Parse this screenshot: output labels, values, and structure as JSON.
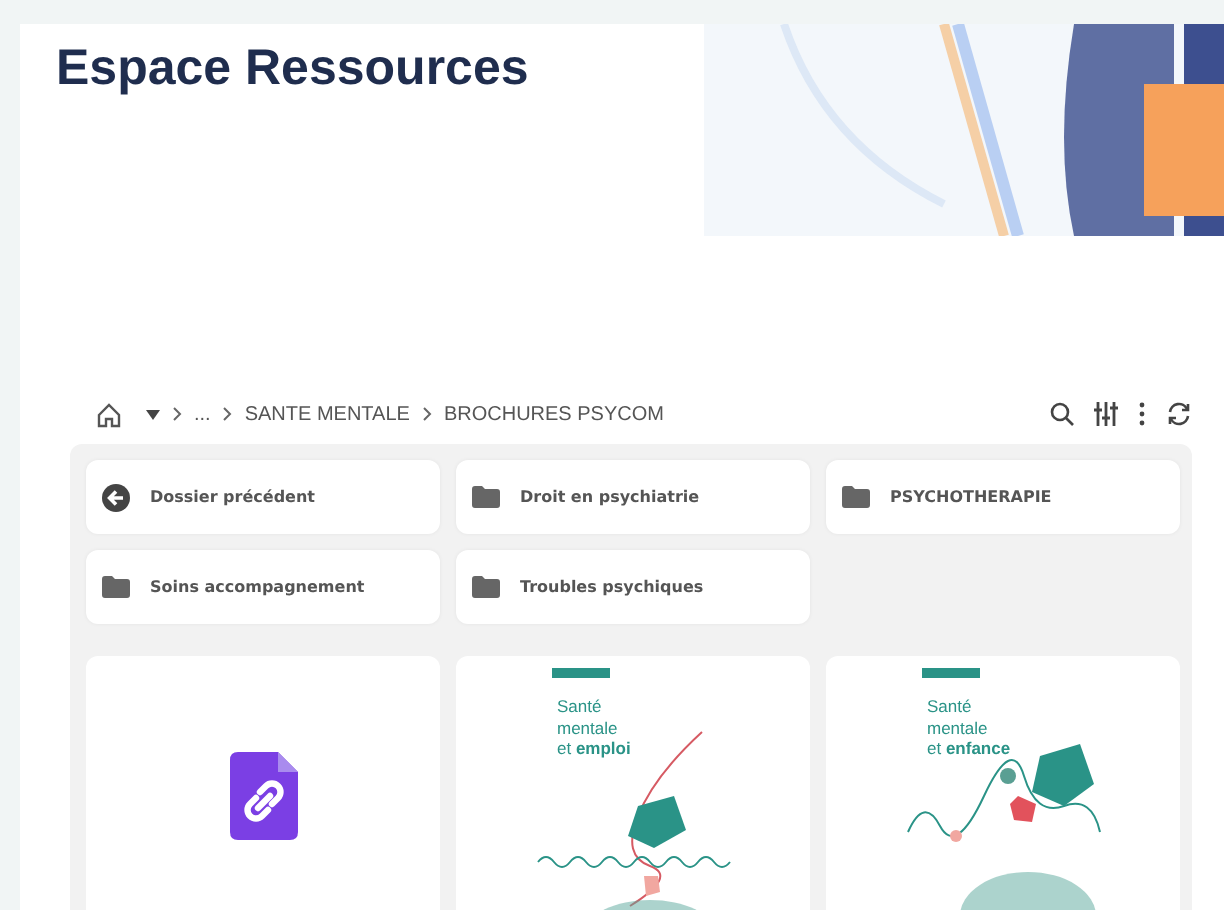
{
  "page": {
    "title": "Espace Ressources"
  },
  "breadcrumb": {
    "ellipsis": "...",
    "items": [
      "SANTE MENTALE",
      "BROCHURES PSYCOM"
    ]
  },
  "folders": [
    {
      "kind": "back",
      "label": "Dossier précédent"
    },
    {
      "kind": "folder",
      "label": "Droit en psychiatrie"
    },
    {
      "kind": "folder",
      "label": "PSYCHOTHERAPIE"
    },
    {
      "kind": "folder",
      "label": "Soins accompagnement"
    },
    {
      "kind": "folder",
      "label": "Troubles psychiques"
    }
  ],
  "files": [
    {
      "kind": "link"
    },
    {
      "kind": "cover",
      "title": "Santé\nmentale\net **emploi**"
    },
    {
      "kind": "cover",
      "title": "Santé\nmentale\net **enfance**"
    }
  ]
}
